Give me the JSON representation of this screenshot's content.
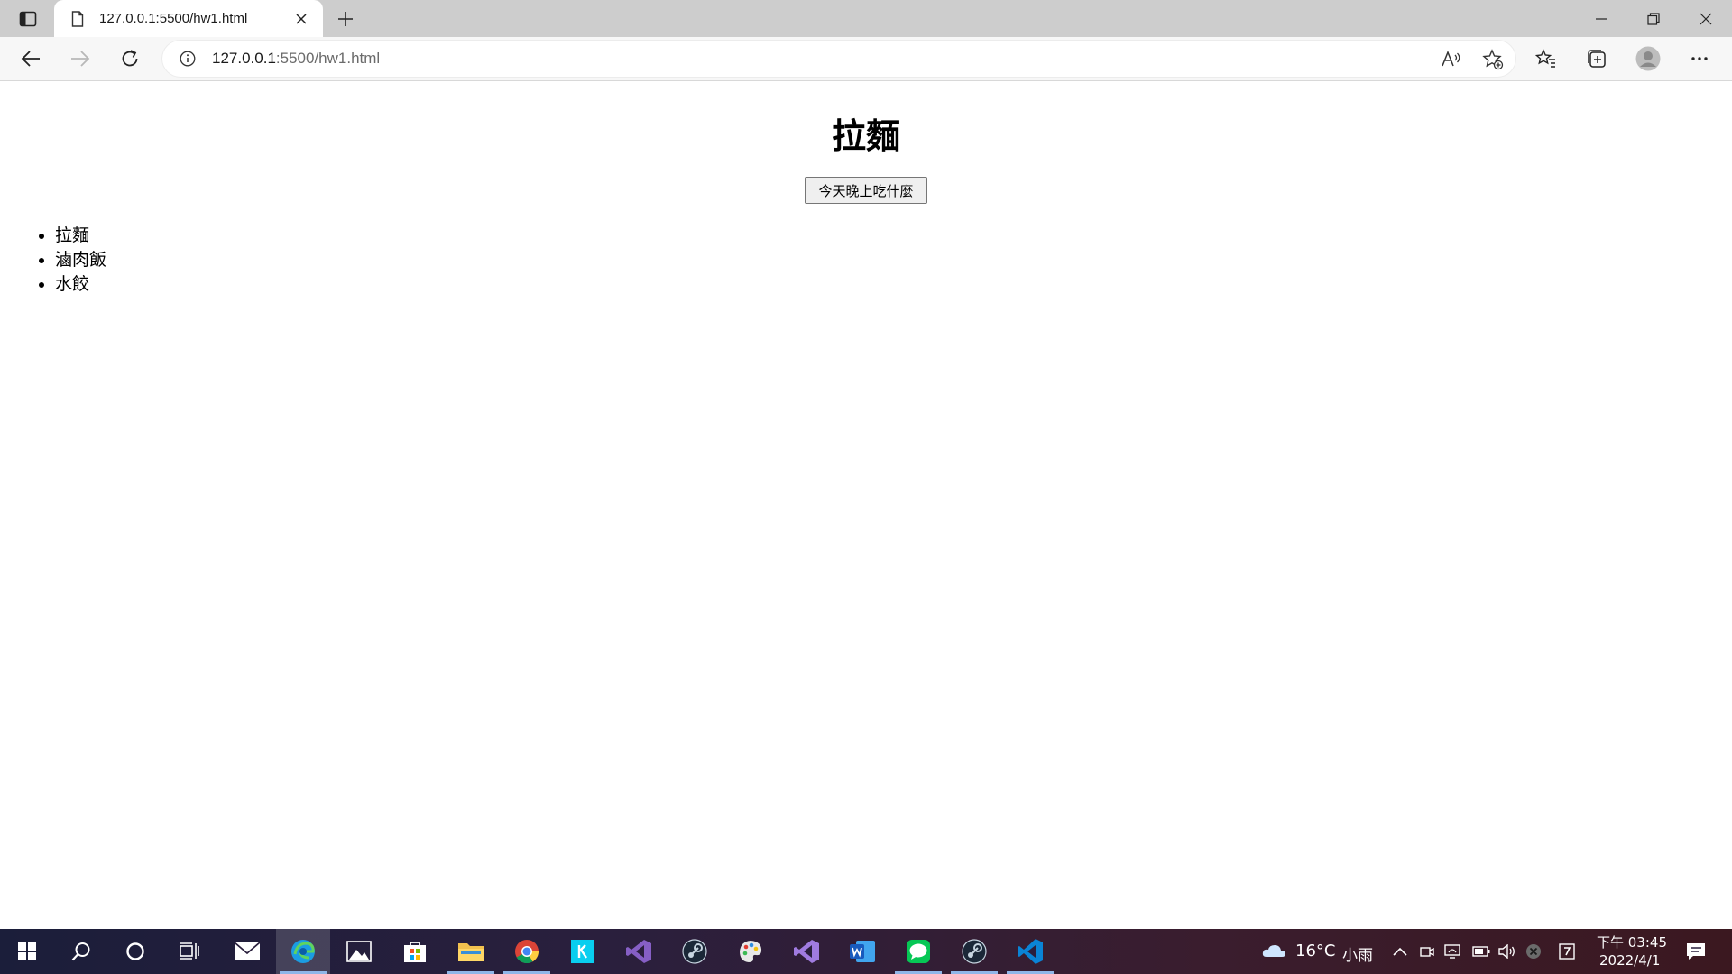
{
  "browser": {
    "tab": {
      "title": "127.0.0.1:5500/hw1.html"
    },
    "address": {
      "host": "127.0.0.1",
      "path": ":5500/hw1.html"
    },
    "accent": "#0078d4"
  },
  "page": {
    "heading": "拉麵",
    "button_label": "今天晚上吃什麼",
    "items": [
      "拉麵",
      "滷肉飯",
      "水餃"
    ]
  },
  "taskbar": {
    "apps": [
      "start-icon",
      "search-icon",
      "cortana-icon",
      "task-view-icon",
      "mail-icon",
      "edge-icon",
      "photos-icon",
      "store-icon",
      "file-explorer-icon",
      "chrome-icon",
      "kkbox-icon",
      "visual-studio-icon",
      "steam-icon",
      "paint-icon",
      "visual-studio-2-icon",
      "word-icon",
      "line-icon",
      "steam-2-icon",
      "vscode-icon"
    ],
    "weather": {
      "temp": "16°C",
      "condition": "小雨"
    },
    "clock": {
      "time": "下午 03:45",
      "date": "2022/4/1"
    }
  }
}
